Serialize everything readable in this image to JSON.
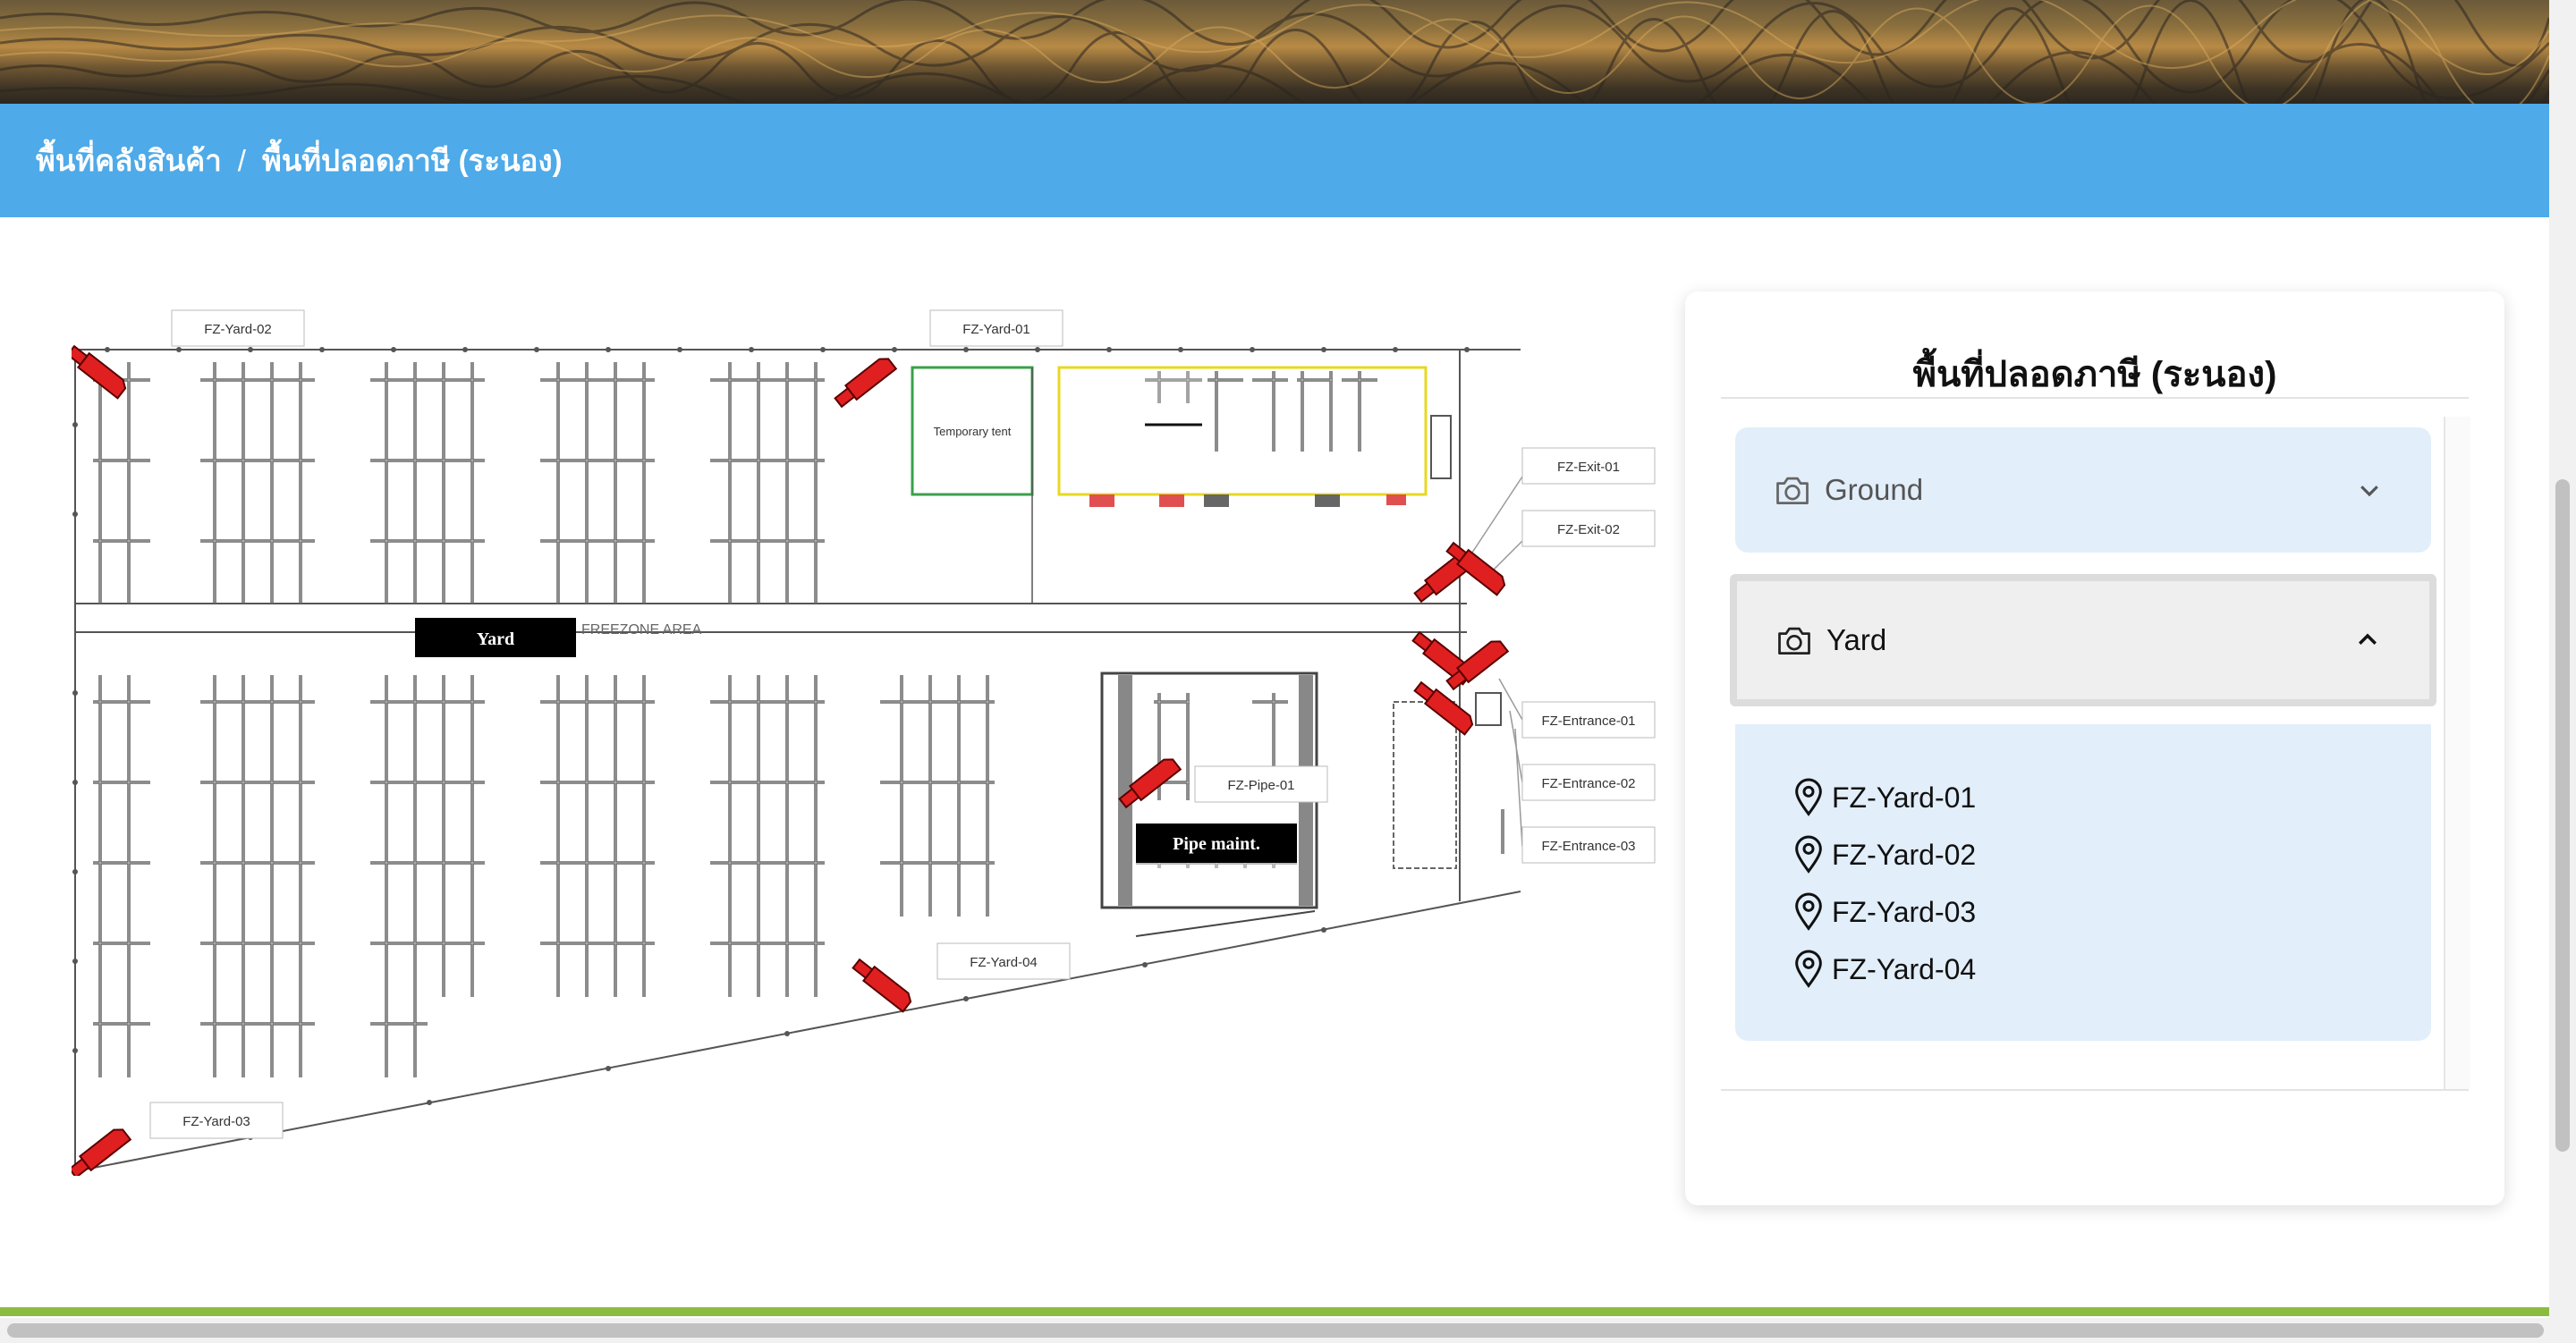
{
  "breadcrumb": {
    "items": [
      "พื้นที่คลังสินค้า",
      "พื้นที่ปลอดภาษี (ระนอง)"
    ],
    "separator": "/"
  },
  "map": {
    "area_labels": {
      "yard": "Yard",
      "pipe": "Pipe maint.",
      "tent": "Temporary tent",
      "freezone": "FREEZONE AREA"
    },
    "cameras": [
      "FZ-Yard-02",
      "FZ-Yard-01",
      "FZ-Exit-01",
      "FZ-Exit-02",
      "FZ-Entrance-01",
      "FZ-Pipe-01",
      "FZ-Entrance-02",
      "FZ-Entrance-03",
      "FZ-Yard-04",
      "FZ-Yard-03"
    ]
  },
  "panel": {
    "title": "พื้นที่ปลอดภาษี (ระนอง)",
    "groups": [
      {
        "label": "Ground",
        "expanded": false,
        "icon": "camera-icon"
      },
      {
        "label": "Yard",
        "expanded": true,
        "icon": "camera-icon"
      }
    ],
    "yard_locations": [
      "FZ-Yard-01",
      "FZ-Yard-02",
      "FZ-Yard-03",
      "FZ-Yard-04"
    ]
  },
  "colors": {
    "header_blue": "#4eaae8",
    "panel_item_bg": "#e2eefa",
    "camera_red": "#e02020",
    "footer_green": "#8cbc3f"
  }
}
